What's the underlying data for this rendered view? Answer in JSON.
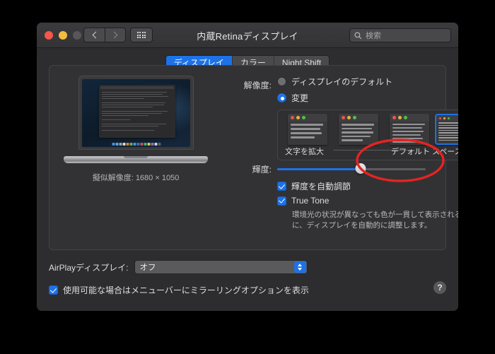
{
  "window": {
    "title": "内蔵Retinaディスプレイ",
    "traffic_lights": [
      "close-button",
      "minimize-button",
      "zoom-button"
    ],
    "nav": {
      "back": "back-button",
      "forward": "forward-button",
      "grid": "show-all-button"
    },
    "search": {
      "placeholder": "検索",
      "icon": "search-icon"
    }
  },
  "tabs": [
    {
      "label": "ディスプレイ",
      "active": true
    },
    {
      "label": "カラー",
      "active": false
    },
    {
      "label": "Night Shift",
      "active": false
    }
  ],
  "display_preview": {
    "pseudo_resolution_label": "擬似解像度: 1680 × 1050"
  },
  "resolution": {
    "label": "解像度:",
    "options": [
      {
        "label": "ディスプレイのデフォルト",
        "selected": false
      },
      {
        "label": "変更",
        "selected": true
      }
    ]
  },
  "scaling": {
    "left_label": "文字を拡大",
    "center_label": "デフォルト",
    "right_label": "スペースを拡大",
    "thumbnails": [
      {
        "name": "scale-option-1",
        "selected": false
      },
      {
        "name": "scale-option-2",
        "selected": false
      },
      {
        "name": "scale-option-3",
        "selected": false
      },
      {
        "name": "scale-option-4",
        "selected": true
      }
    ]
  },
  "brightness": {
    "label": "輝度:",
    "value_percent": 56,
    "auto_adjust": {
      "label": "輝度を自動調節",
      "checked": true
    },
    "true_tone": {
      "label": "True Tone",
      "checked": true
    },
    "true_tone_description": "環境光の状況が異なっても色が一貫して表示されるように、ディスプレイを自動的に調整します。"
  },
  "airplay": {
    "label": "AirPlayディスプレイ:",
    "value": "オフ"
  },
  "mirroring": {
    "label": "使用可能な場合はメニューバーにミラーリングオプションを表示",
    "checked": true
  },
  "help": {
    "label": "?"
  },
  "annotation": {
    "shape": "ellipse",
    "color": "#e52421",
    "target": "スペースを拡大"
  },
  "colors": {
    "accent": "#1d72e8",
    "window_bg": "#2d2d2f",
    "panel_bg": "#323234",
    "annotation_red": "#e52421"
  }
}
